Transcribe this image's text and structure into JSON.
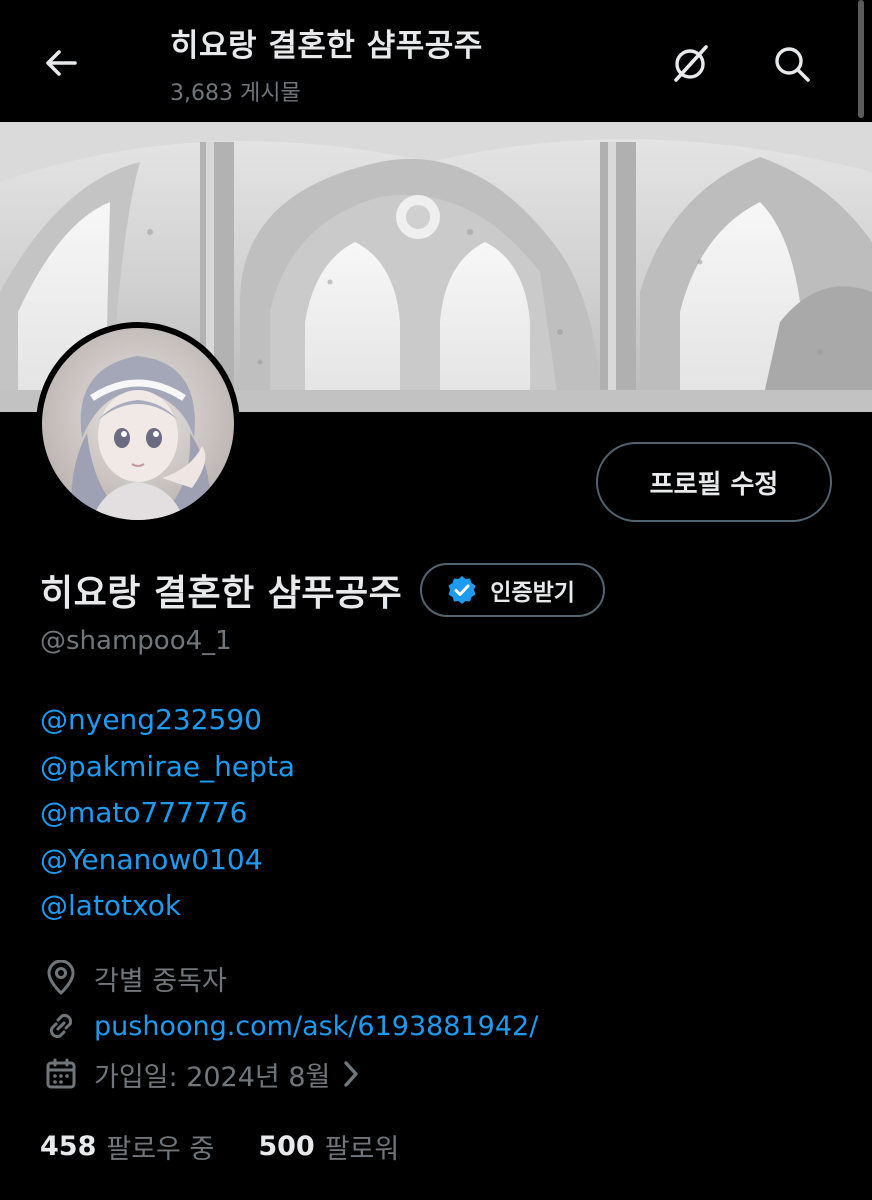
{
  "header": {
    "title": "히요랑 결혼한 샴푸공주",
    "post_count": "3,683 게시물"
  },
  "profile": {
    "edit_button": "프로필 수정",
    "display_name": "히요랑 결혼한 샴푸공주",
    "verify_button": "인증받기",
    "handle": "@shampoo4_1",
    "bio_lines": [
      "@nyeng232590",
      "@pakmirae_hepta",
      "@mato777776",
      "@Yenanow0104",
      "@latotxok"
    ],
    "location": "각별 중독자",
    "website": "pushoong.com/ask/6193881942/",
    "joined": "가입일: 2024년 8월",
    "following_count": "458",
    "following_label": "팔로우 중",
    "followers_count": "500",
    "followers_label": "팔로워"
  },
  "colors": {
    "background": "#000000",
    "text_primary": "#e7e9ea",
    "text_secondary": "#71767b",
    "link": "#1d9bf0",
    "border": "#536471"
  },
  "icons": [
    "back-arrow-icon",
    "grok-icon",
    "search-icon",
    "verified-badge-icon",
    "location-pin-icon",
    "link-icon",
    "calendar-icon",
    "chevron-right-icon"
  ]
}
